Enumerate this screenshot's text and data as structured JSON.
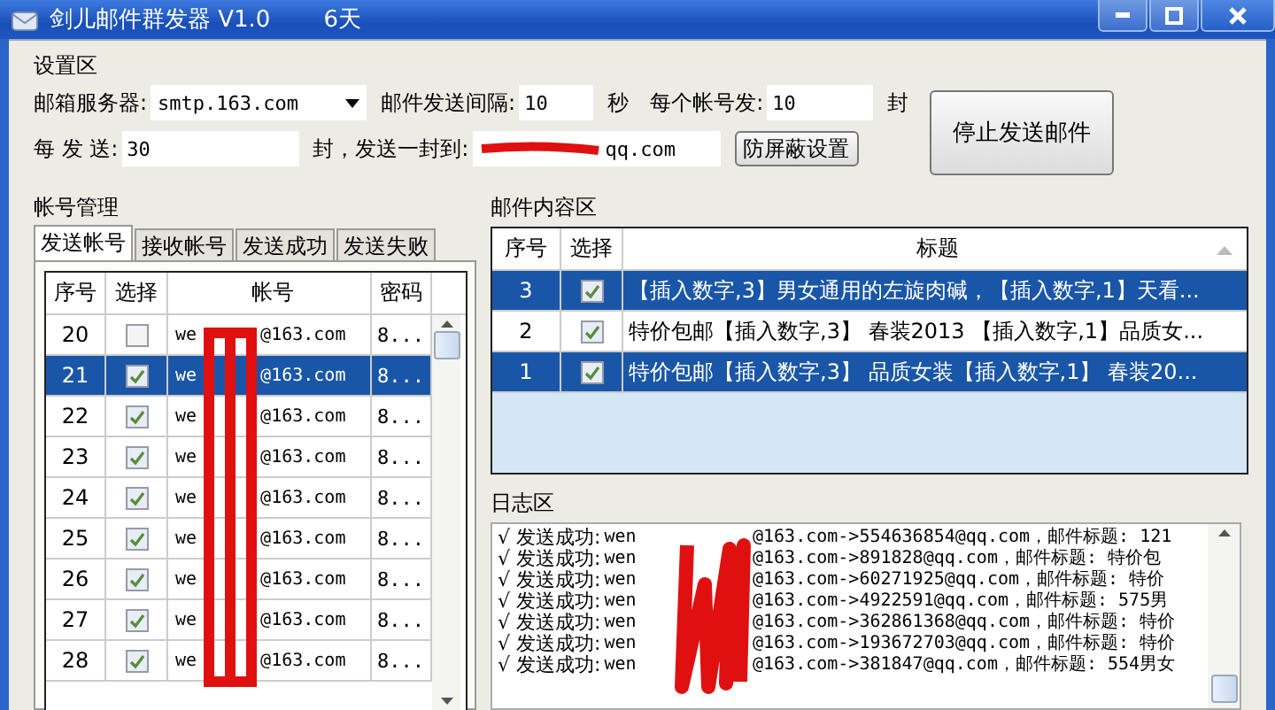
{
  "window": {
    "title": "剑儿邮件群发器 V1.0",
    "days": "6天"
  },
  "settings": {
    "title": "设置区",
    "server_label": "邮箱服务器:",
    "server": "smtp.163.com",
    "interval_label": "邮件发送间隔:",
    "interval": "10",
    "interval_unit": "秒",
    "per_account_label": "每个帐号发:",
    "per_account": "10",
    "per_account_unit": "封",
    "each_label": "每 发 送:",
    "each": "30",
    "sendto_label": "封，发送一封到:",
    "sendto_visible": "qq.com",
    "shield_button": "防屏蔽设置",
    "stop_button": "停止发送邮件"
  },
  "accounts": {
    "title": "帐号管理",
    "tabs": [
      {
        "label": "发送帐号",
        "selected": true
      },
      {
        "label": "接收帐号",
        "selected": false
      },
      {
        "label": "发送成功",
        "selected": false
      },
      {
        "label": "发送失败",
        "selected": false
      }
    ],
    "columns": [
      "序号",
      "选择",
      "帐号",
      "密码"
    ],
    "rows": [
      {
        "no": "20",
        "checked": false,
        "selected": false,
        "account_start": "we",
        "account_end": "@163.com",
        "password": "8..."
      },
      {
        "no": "21",
        "checked": true,
        "selected": true,
        "account_start": "we",
        "account_end": "@163.com",
        "password": "8..."
      },
      {
        "no": "22",
        "checked": true,
        "selected": false,
        "account_start": "we",
        "account_end": "@163.com",
        "password": "8..."
      },
      {
        "no": "23",
        "checked": true,
        "selected": false,
        "account_start": "we",
        "account_end": "@163.com",
        "password": "8..."
      },
      {
        "no": "24",
        "checked": true,
        "selected": false,
        "account_start": "we",
        "account_end": "@163.com",
        "password": "8..."
      },
      {
        "no": "25",
        "checked": true,
        "selected": false,
        "account_start": "we",
        "account_end": "@163.com",
        "password": "8..."
      },
      {
        "no": "26",
        "checked": true,
        "selected": false,
        "account_start": "we",
        "account_end": "@163.com",
        "password": "8..."
      },
      {
        "no": "27",
        "checked": true,
        "selected": false,
        "account_start": "we",
        "account_end": "@163.com",
        "password": "8..."
      },
      {
        "no": "28",
        "checked": true,
        "selected": false,
        "account_start": "we",
        "account_end": "@163.com",
        "password": "8..."
      }
    ]
  },
  "mail": {
    "title": "邮件内容区",
    "columns": [
      "序号",
      "选择",
      "标题"
    ],
    "rows": [
      {
        "no": "3",
        "checked": true,
        "selected": true,
        "title": "【插入数字,3】男女通用的左旋肉碱，【插入数字,1】天看..."
      },
      {
        "no": "2",
        "checked": true,
        "selected": false,
        "title": "特价包邮【插入数字,3】 春装2013 【插入数字,1】品质女..."
      },
      {
        "no": "1",
        "checked": true,
        "selected": true,
        "title": "特价包邮【插入数字,3】 品质女装【插入数字,1】 春装20..."
      }
    ]
  },
  "log": {
    "title": "日志区",
    "lines": [
      {
        "status": "√ 发送成功:",
        "from_start": "wen",
        "rest": "@163.com->554636854@qq.com，邮件标题: 121"
      },
      {
        "status": "√ 发送成功:",
        "from_start": "wen",
        "rest": "@163.com->891828@qq.com，邮件标题: 特价包"
      },
      {
        "status": "√ 发送成功:",
        "from_start": "wen",
        "rest": "@163.com->60271925@qq.com，邮件标题: 特价"
      },
      {
        "status": "√ 发送成功:",
        "from_start": "wen",
        "rest": "@163.com->4922591@qq.com，邮件标题: 575男"
      },
      {
        "status": "√ 发送成功:",
        "from_start": "wen",
        "rest": "@163.com->362861368@qq.com，邮件标题: 特价"
      },
      {
        "status": "√ 发送成功:",
        "from_start": "wen",
        "rest": "@163.com->193672703@qq.com，邮件标题: 特价"
      },
      {
        "status": "√ 发送成功:",
        "from_start": "wen",
        "rest": "@163.com->381847@qq.com，邮件标题: 554男女"
      }
    ]
  }
}
